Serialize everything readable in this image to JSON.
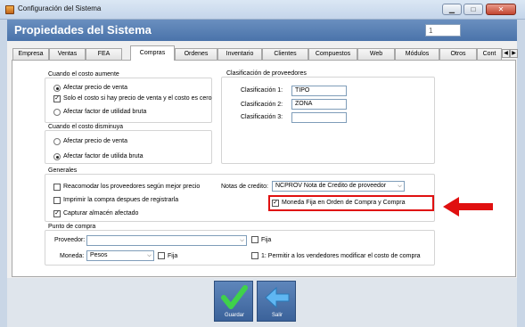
{
  "window": {
    "title": "Configuración del Sistema"
  },
  "header": {
    "title": "Propiedades del Sistema",
    "field_value": "1"
  },
  "tabs": [
    "Empresa",
    "Ventas",
    "FEA",
    "Compras",
    "Ordenes",
    "Inventario",
    "Clientes",
    "Compuestos",
    "Web",
    "Módulos",
    "Otros",
    "Cont"
  ],
  "active_tab": "Compras",
  "costo_aumente": {
    "title": "Cuando el costo aumente",
    "options": [
      "Afectar precio de venta",
      "Afectar factor de utilidad bruta"
    ],
    "checkbox": "Solo el costo si hay precio de venta y el costo es cero"
  },
  "costo_disminuya": {
    "title": "Cuando el costo disminuya",
    "options": [
      "Afectar precio de venta",
      "Afectar factor de utilida bruta"
    ]
  },
  "clasificacion": {
    "title": "Clasificación de proveedores",
    "labels": [
      "Clasificación 1:",
      "Clasificación 2:",
      "Clasificación 3:"
    ],
    "values": [
      "TIPO",
      "ZONA",
      ""
    ]
  },
  "generales": {
    "title": "Generales",
    "checks": [
      "Reacomodar los proveedores según mejor precio",
      "Imprimir la compra despues de registrarla",
      "Capturar almacén afectado"
    ],
    "notas_label": "Notas de credito:",
    "notas_value": "NCPROV Nota de Credito de proveedor",
    "moneda_fija": "Moneda Fija en Orden de Compra y Compra"
  },
  "punto_compra": {
    "title": "Punto de compra",
    "proveedor_label": "Proveedor:",
    "proveedor_value": "",
    "fija": "Fija",
    "moneda_label": "Moneda:",
    "moneda_value": "Pesos",
    "permitir": "1: Permitir a los vendedores modificar el costo de compra"
  },
  "buttons": {
    "guardar": "Guardar",
    "salir": "Salir"
  },
  "colors": {
    "accent_red": "#e01010",
    "header_blue": "#4a73aa"
  }
}
